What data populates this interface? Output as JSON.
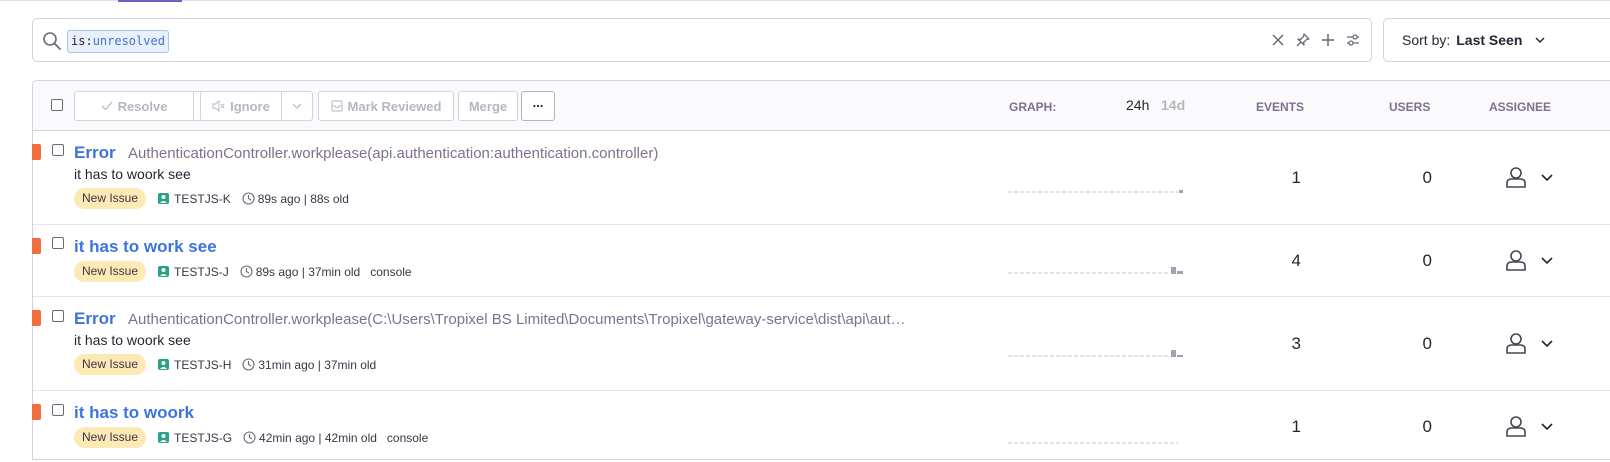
{
  "search": {
    "token_key": "is:",
    "token_value": "unresolved"
  },
  "sort": {
    "label": "Sort by:",
    "value": "Last Seen"
  },
  "toolbar": {
    "resolve": "Resolve",
    "ignore": "Ignore",
    "mark_reviewed": "Mark Reviewed",
    "merge": "Merge",
    "more": "..."
  },
  "columns": {
    "graph": "GRAPH:",
    "period_24h": "24h",
    "period_14d": "14d",
    "events": "EVENTS",
    "users": "USERS",
    "assignee": "ASSIGNEE"
  },
  "issues": [
    {
      "title": "Error",
      "culprit": "AuthenticationController.workplease(api.authentication:authentication.controller)",
      "message": "it has to woork see",
      "badge": "New Issue",
      "project": "TESTJS-K",
      "time": "89s ago | 88s old",
      "extra": "",
      "events": "1",
      "users": "0"
    },
    {
      "title": "it has to work see",
      "culprit": "",
      "message": "",
      "badge": "New Issue",
      "project": "TESTJS-J",
      "time": "89s ago | 37min old",
      "extra": "console",
      "events": "4",
      "users": "0"
    },
    {
      "title": "Error",
      "culprit": "AuthenticationController.workplease(C:\\Users\\Tropixel BS Limited\\Documents\\Tropixel\\gateway-service\\dist\\api\\aut…",
      "message": "it has to woork see",
      "badge": "New Issue",
      "project": "TESTJS-H",
      "time": "31min ago | 37min old",
      "extra": "",
      "events": "3",
      "users": "0"
    },
    {
      "title": "it has to woork",
      "culprit": "",
      "message": "",
      "badge": "New Issue",
      "project": "TESTJS-G",
      "time": "42min ago | 42min old",
      "extra": "console",
      "events": "1",
      "users": "0"
    }
  ],
  "colors": {
    "accent": "#6c5fc7",
    "link": "#3d74db",
    "level_error": "#f26d3d",
    "badge_new": "#fde9b4"
  }
}
